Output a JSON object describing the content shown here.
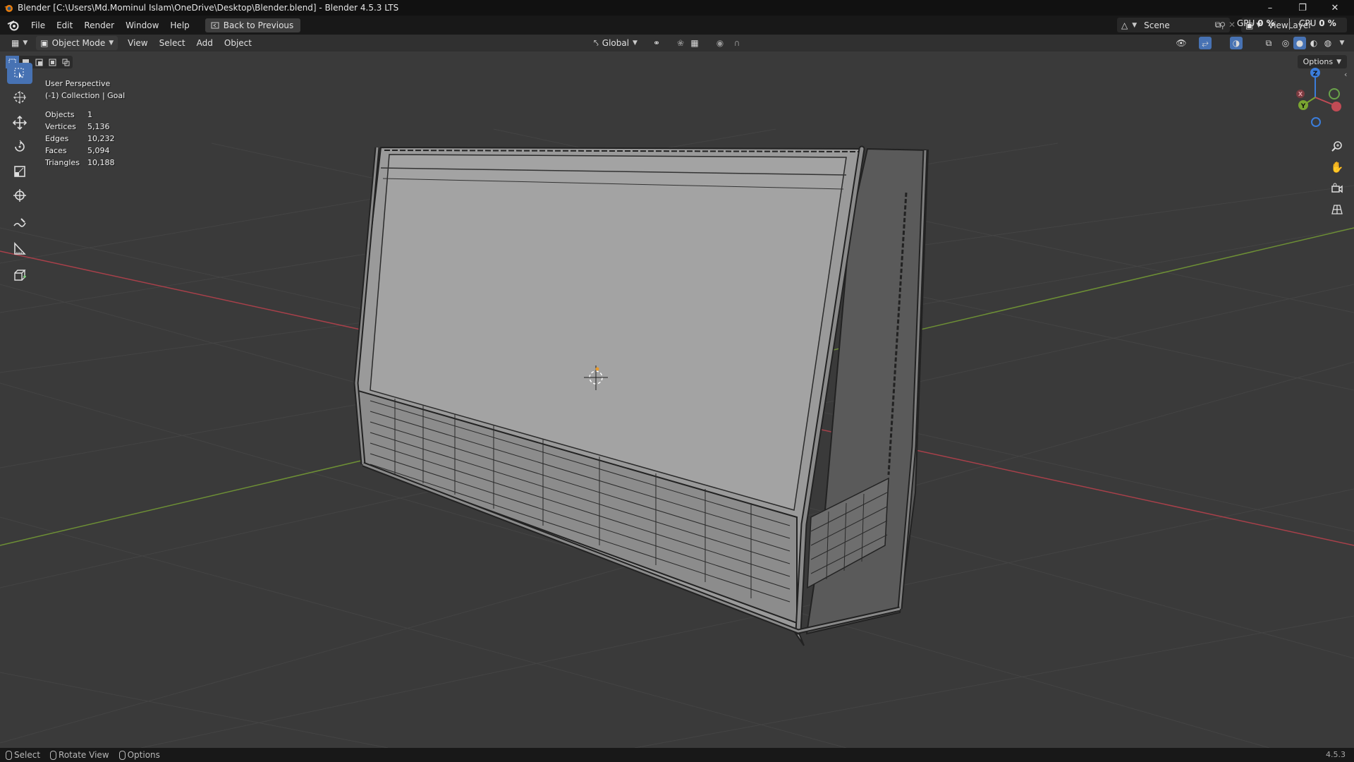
{
  "window": {
    "title": "Blender [C:\\Users\\Md.Mominul Islam\\OneDrive\\Desktop\\Blender.blend] - Blender 4.5.3 LTS",
    "controls": [
      "minimize",
      "restore",
      "close"
    ]
  },
  "menubar": {
    "items": [
      "File",
      "Edit",
      "Render",
      "Window",
      "Help"
    ],
    "back_button": "Back to Previous",
    "scene": "Scene",
    "view_layer": "ViewLayer",
    "gpu_label": "GPU",
    "gpu_value": "0 %",
    "cpu_label": "CPU",
    "cpu_value": "0 %"
  },
  "viewport_header": {
    "mode": "Object Mode",
    "menus": [
      "View",
      "Select",
      "Add",
      "Object"
    ],
    "orientation": "Global"
  },
  "viewport": {
    "view_name": "User Perspective",
    "collection": "(-1) Collection | Goal",
    "options_label": "Options",
    "stats": [
      {
        "label": "Objects",
        "value": "1"
      },
      {
        "label": "Vertices",
        "value": "5,136"
      },
      {
        "label": "Edges",
        "value": "10,232"
      },
      {
        "label": "Faces",
        "value": "5,094"
      },
      {
        "label": "Triangles",
        "value": "10,188"
      }
    ],
    "gizmo": {
      "x": "X",
      "y": "Y",
      "z": "Z"
    },
    "colors": {
      "background": "#3a3a3a",
      "x_axis": "#a8404a",
      "y_axis": "#6d8f35",
      "accent": "#4772b3"
    }
  },
  "toolbar": {
    "tools": [
      "select-box",
      "cursor",
      "move",
      "rotate",
      "scale",
      "transform",
      "annotate",
      "measure",
      "add-cube"
    ]
  },
  "statusbar": {
    "items": [
      "Select",
      "Rotate View",
      "Options"
    ],
    "version": "4.5.3"
  }
}
